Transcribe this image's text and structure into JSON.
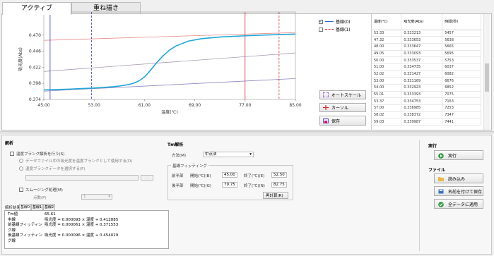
{
  "tabs": [
    {
      "label": "アクティブ"
    },
    {
      "label": "重ね描き"
    }
  ],
  "chart_data": {
    "type": "line",
    "title": "",
    "xlabel": "温度(℃)",
    "ylabel": "吸光度(Abs)",
    "x_ticks": [
      "45.00",
      "53.00",
      "61.00",
      "69.00",
      "77.00",
      "85.00"
    ],
    "y_ticks": [
      "0.374",
      "0.398",
      "0.422",
      "0.446",
      "0.470"
    ],
    "xlim": [
      45,
      85
    ],
    "ylim": [
      0.374,
      0.494
    ],
    "series": [
      {
        "name": "",
        "color": "#1fa7d6",
        "x": [
          45,
          47,
          49,
          51,
          53,
          55,
          56,
          57,
          58,
          59,
          59.5,
          60,
          60.5,
          61,
          61.5,
          62,
          62.5,
          63,
          64,
          65,
          66,
          68,
          70,
          73,
          77,
          81,
          85
        ],
        "values": [
          0.3882,
          0.3888,
          0.3894,
          0.3902,
          0.391,
          0.3922,
          0.393,
          0.394,
          0.3954,
          0.3974,
          0.399,
          0.4012,
          0.404,
          0.4078,
          0.4125,
          0.418,
          0.4238,
          0.4295,
          0.4395,
          0.4478,
          0.4538,
          0.4611,
          0.4646,
          0.4672,
          0.469,
          0.4704,
          0.4716
        ]
      },
      {
        "name": "",
        "color": "#e88a8a",
        "x": [
          45,
          85
        ],
        "values": [
          0.4622,
          0.4738
        ]
      },
      {
        "name": "",
        "color": "#a89bb5",
        "x": [
          45,
          85
        ],
        "values": [
          0.4158,
          0.4434
        ]
      },
      {
        "name": "",
        "color": "#8e86c2",
        "x": [
          45,
          85
        ],
        "values": [
          0.3864,
          0.4052
        ]
      }
    ],
    "vlines": [
      {
        "x": 46.0,
        "color": "#3333cc",
        "style": "solid"
      },
      {
        "x": 52.6,
        "color": "#3333cc",
        "style": "dashed"
      },
      {
        "x": 77.0,
        "color": "#cc3333",
        "style": "solid"
      },
      {
        "x": 82.4,
        "color": "#cc3333",
        "style": "dashed"
      }
    ],
    "grid": false
  },
  "legend": [
    {
      "label": "基線(0)",
      "checked": true,
      "color": "#2a6bd1"
    },
    {
      "label": "基線(1)",
      "checked": false,
      "color": "#cc3333"
    }
  ],
  "chart_buttons": {
    "auto_scale": "オートスケール",
    "cursor": "カーソル",
    "save": "保存"
  },
  "table": {
    "headers": [
      "温度(℃)",
      "吸光度(Abs)",
      "時間(秒)"
    ],
    "rows": [
      [
        "53.33",
        "0.333213",
        "5457"
      ],
      [
        "47.32",
        "0.333653",
        "5638"
      ],
      [
        "48.00",
        "0.333647",
        "5665"
      ],
      [
        "49.05",
        "0.333093",
        "5695"
      ],
      [
        "50.00",
        "0.333537",
        "5753"
      ],
      [
        "51.00",
        "0.334735",
        "6037"
      ],
      [
        "52.02",
        "0.331427",
        "6082"
      ],
      [
        "53.00",
        "0.331169",
        "6676"
      ],
      [
        "54.00",
        "0.332923",
        "6852"
      ],
      [
        "55.01",
        "0.333393",
        "7075"
      ],
      [
        "53.37",
        "0.334753",
        "7163"
      ],
      [
        "57.00",
        "0.336985",
        "7253"
      ],
      [
        "58.02",
        "0.338372",
        "7347"
      ],
      [
        "59.03",
        "0.339987",
        "7441"
      ]
    ]
  },
  "bottom": {
    "analysis_title": "解析",
    "separate_group": "温度ブランク解析を行う(S)",
    "radio1": "データファイル中の吸光度を温度ブランクとして使用する(D)",
    "radio2": "温度ブランクデータを選択する(F)",
    "radio2_file": "",
    "browse": "...",
    "smoothing": "スムージング処理(M)",
    "points_label": "点数(P)",
    "points_value": "1",
    "tm_title": "Tm解析",
    "method_label": "方法(M)",
    "method_value": "中点法",
    "baseline_title": "基線フィッティング",
    "lower_label": "前半部",
    "lower_start_label": "開始(℃)(B)",
    "lower_start": "45.00",
    "lower_end_label": "終了(℃)(E)",
    "lower_end": "52.50",
    "upper_label": "後半部",
    "upper_start_label": "開始(℃)(G)",
    "upper_start": "79.75",
    "upper_end_label": "終了(℃)(N)",
    "upper_end": "82.75",
    "calc_button": "再計算(R)",
    "results_title": "解析結果",
    "result_tabs": [
      "基線0",
      "基線1",
      "基線2"
    ],
    "results": [
      {
        "k": "Tm値",
        "v": "65.61"
      },
      {
        "k": "中線",
        "v": "吸光度 = 0.000093 × 温度 + 0.412885"
      },
      {
        "k": "前基線フィッティング線",
        "v": "吸光度 = 0.000061 × 温度 + 0.371553"
      },
      {
        "k": "後基線フィッティング線",
        "v": "吸光度 = 0.000096 × 温度 + 0.454029"
      }
    ],
    "run_title": "実行",
    "run_button": "実行",
    "files_title": "ファイル",
    "load_button": "読み込み",
    "save_as_button": "名前を付けて保存",
    "apply_all_button": "全データに適用"
  }
}
